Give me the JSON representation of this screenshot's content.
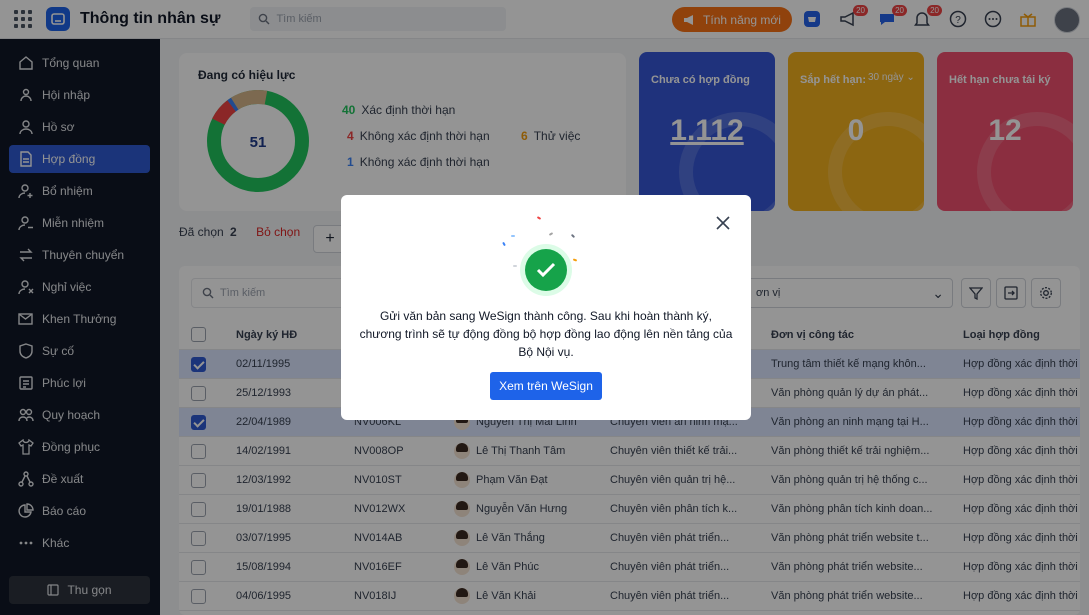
{
  "app": {
    "title": "Thông tin nhân sự"
  },
  "topbar": {
    "search_placeholder": "Tìm kiếm",
    "new_feature_label": "Tính năng mới",
    "badges": [
      "20",
      "20",
      "20"
    ]
  },
  "sidebar": {
    "items": [
      {
        "label": "Tổng quan",
        "icon": "home-icon"
      },
      {
        "label": "Hội nhập",
        "icon": "users-icon"
      },
      {
        "label": "Hồ sơ",
        "icon": "user-icon"
      },
      {
        "label": "Hợp đồng",
        "icon": "document-icon",
        "active": true
      },
      {
        "label": "Bổ nhiệm",
        "icon": "user-plus-icon"
      },
      {
        "label": "Miễn nhiệm",
        "icon": "user-minus-icon"
      },
      {
        "label": "Thuyên chuyển",
        "icon": "transfer-icon"
      },
      {
        "label": "Nghỉ việc",
        "icon": "user-x-icon"
      },
      {
        "label": "Khen Thưởng",
        "icon": "mail-award-icon"
      },
      {
        "label": "Sự cố",
        "icon": "shield-alert-icon"
      },
      {
        "label": "Phúc lợi",
        "icon": "benefit-icon"
      },
      {
        "label": "Quy hoạch",
        "icon": "group-icon"
      },
      {
        "label": "Đồng phục",
        "icon": "shirt-icon"
      },
      {
        "label": "Đề xuất",
        "icon": "share-icon"
      },
      {
        "label": "Báo cáo",
        "icon": "pie-icon"
      },
      {
        "label": "Khác",
        "icon": "more-icon"
      }
    ],
    "collapse_label": "Thu gọn"
  },
  "summary": {
    "title": "Đang có hiệu lực",
    "total": "51",
    "legend": [
      {
        "count": "40",
        "label": "Xác định thời hạn",
        "color": "#22c55e"
      },
      {
        "count": "4",
        "label": "Không xác định thời hạn",
        "color": "#ef4444"
      },
      {
        "count": "6",
        "label": "Thử việc",
        "color": "#f59e0b"
      },
      {
        "count": "1",
        "label": "Không xác định thời hạn",
        "color": "#3b82f6"
      }
    ]
  },
  "kpis": [
    {
      "label": "Chưa có hợp đồng",
      "value": "1.112",
      "color": "#3657d6"
    },
    {
      "label": "Sắp hết hạn:",
      "period": "30 ngày",
      "value": "0",
      "color": "#f2b01e"
    },
    {
      "label": "Hết hạn chưa tái ký",
      "value": "12",
      "color": "#f0506e"
    }
  ],
  "selection": {
    "prefix": "Đã chọn",
    "count": "2",
    "clear_label": "Bỏ chọn"
  },
  "table": {
    "search_placeholder": "Tìm kiếm",
    "unit_placeholder": "ơn vị",
    "headers": {
      "date": "Ngày ký HĐ",
      "unit": "Đơn vị công tác",
      "type": "Loại hợp đồng"
    },
    "rows": [
      {
        "date": "02/11/1995",
        "code": "",
        "name": "",
        "position": "",
        "unit": "Trung tâm thiết kế mạng khôn...",
        "type": "Hợp đồng xác định thời",
        "selected": true
      },
      {
        "date": "25/12/1993",
        "code": "",
        "name": "",
        "position": "",
        "unit": "Văn phòng quản lý dự án phát...",
        "type": "Hợp đồng xác định thời",
        "selected": false
      },
      {
        "date": "22/04/1989",
        "code": "NV006KL",
        "name": "Nguyễn Thị Mai Linh",
        "position": "Chuyên viên an ninh mạ...",
        "unit": "Văn phòng an ninh mạng tại H...",
        "type": "Hợp đồng xác định thời",
        "selected": true
      },
      {
        "date": "14/02/1991",
        "code": "NV008OP",
        "name": "Lê Thị Thanh Tâm",
        "position": "Chuyên viên thiết kế trải...",
        "unit": "Văn phòng thiết kế trải nghiệm...",
        "type": "Hợp đồng xác định thời",
        "selected": false
      },
      {
        "date": "12/03/1992",
        "code": "NV010ST",
        "name": "Phạm Văn Đạt",
        "position": "Chuyên viên quản trị hệ...",
        "unit": "Văn phòng quản trị hệ thống c...",
        "type": "Hợp đồng xác định thời",
        "selected": false
      },
      {
        "date": "19/01/1988",
        "code": "NV012WX",
        "name": "Nguyễn Văn Hưng",
        "position": "Chuyên viên phân tích k...",
        "unit": "Văn phòng phân tích kinh doan...",
        "type": "Hợp đồng xác định thời",
        "selected": false
      },
      {
        "date": "03/07/1995",
        "code": "NV014AB",
        "name": "Lê Văn Thắng",
        "position": "Chuyên viên phát triển...",
        "unit": "Văn phòng phát triển website t...",
        "type": "Hợp đồng xác định thời",
        "selected": false
      },
      {
        "date": "15/08/1994",
        "code": "NV016EF",
        "name": "Lê Văn Phúc",
        "position": "Chuyên viên phát triển...",
        "unit": "Văn phòng phát triển website...",
        "type": "Hợp đồng xác định thời",
        "selected": false
      },
      {
        "date": "04/06/1995",
        "code": "NV018IJ",
        "name": "Lê Văn Khải",
        "position": "Chuyên viên phát triển...",
        "unit": "Văn phòng phát triển website...",
        "type": "Hợp đồng xác định thời",
        "selected": false
      }
    ]
  },
  "modal": {
    "message": "Gửi văn bản sang WeSign thành công. Sau khi hoàn thành ký, chương trình sẽ tự động đồng bộ hợp đồng lao động lên nền tảng của Bộ Nội vụ.",
    "button_label": "Xem trên WeSign"
  }
}
